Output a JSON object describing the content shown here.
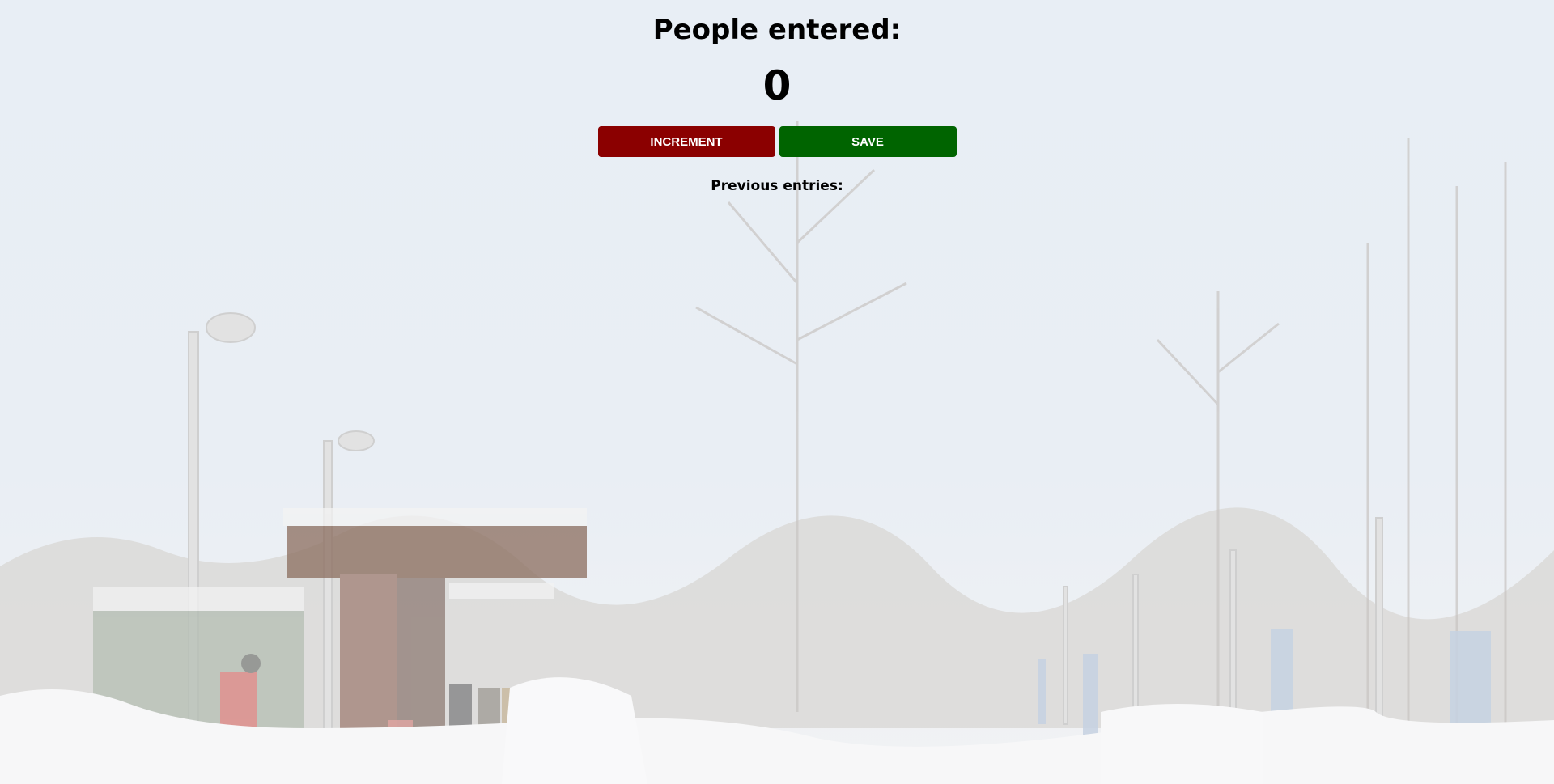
{
  "header": {
    "title": "People entered:"
  },
  "counter": {
    "value": "0"
  },
  "actions": {
    "increment_label": "INCREMENT",
    "save_label": "SAVE"
  },
  "history": {
    "label": "Previous entries:",
    "entries": []
  },
  "colors": {
    "increment_button": "#8b0000",
    "save_button": "#006400"
  }
}
